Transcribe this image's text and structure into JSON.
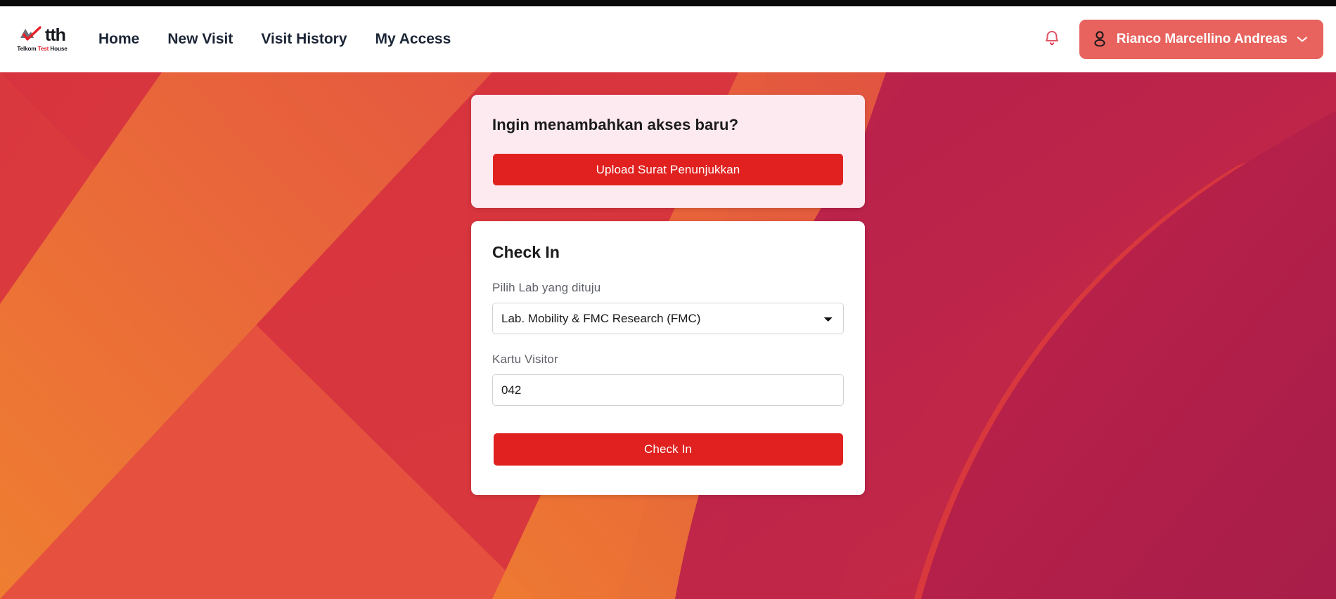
{
  "brand": {
    "mark": "mountain-check-logo",
    "word": "tth",
    "sub_prefix": "Telkom ",
    "sub_highlight": "Test",
    "sub_suffix": " House",
    "accent": "#e8202a"
  },
  "navbar": {
    "links": [
      {
        "label": "Home"
      },
      {
        "label": "New Visit"
      },
      {
        "label": "Visit History"
      },
      {
        "label": "My Access"
      }
    ],
    "notification_icon": "bell-icon",
    "user": {
      "avatar_icon": "person-icon",
      "name": "Rianco Marcellino Andreas",
      "chevron_icon": "chevron-down-icon",
      "chip_color": "#e8635e"
    }
  },
  "access_card": {
    "title": "Ingin menambahkan akses baru?",
    "upload_button": "Upload Surat Penunjukkan",
    "background": "#fdeaf0",
    "button_color": "#e0211f"
  },
  "checkin_card": {
    "title": "Check In",
    "lab_label": "Pilih Lab yang dituju",
    "lab_value": "Lab. Mobility & FMC Research (FMC)",
    "lab_options": [
      "Lab. Mobility & FMC Research (FMC)"
    ],
    "card_label": "Kartu Visitor",
    "card_value": "042",
    "card_placeholder": "",
    "submit_button": "Check In",
    "button_color": "#e0211f"
  },
  "background": {
    "base": "#e8503c",
    "band_crimson": "#c0274a",
    "band_red": "#d8343c",
    "band_orange": "#e96a34"
  }
}
